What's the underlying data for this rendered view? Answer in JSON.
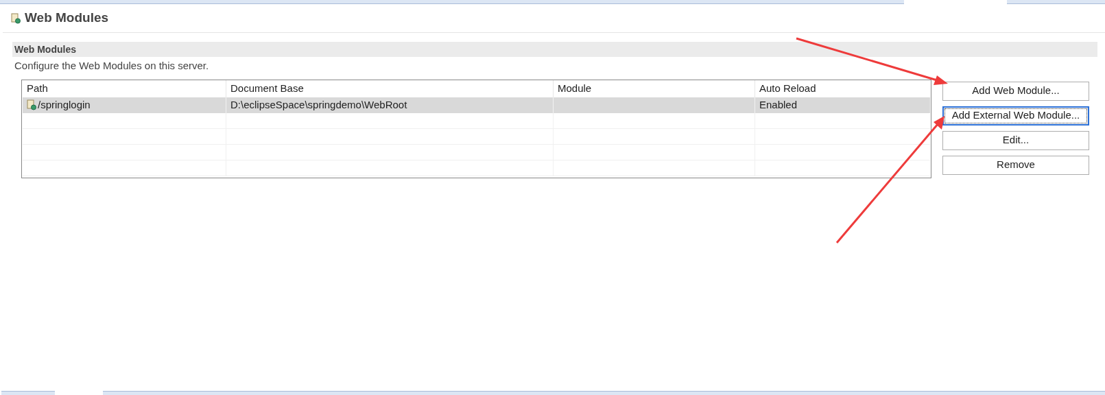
{
  "page": {
    "title": "Web Modules"
  },
  "section": {
    "title": "Web Modules",
    "description": "Configure the Web Modules on this server."
  },
  "table": {
    "columns": [
      "Path",
      "Document Base",
      "Module",
      "Auto Reload"
    ],
    "rows": [
      {
        "selected": true,
        "cells": [
          "/springlogin",
          "D:\\eclipseSpace\\springdemo\\WebRoot",
          "",
          "Enabled"
        ]
      }
    ]
  },
  "buttons": [
    {
      "label": "Add Web Module...",
      "focused": false
    },
    {
      "label": "Add External Web Module...",
      "focused": true
    },
    {
      "label": "Edit...",
      "focused": false
    },
    {
      "label": "Remove",
      "focused": false
    }
  ]
}
